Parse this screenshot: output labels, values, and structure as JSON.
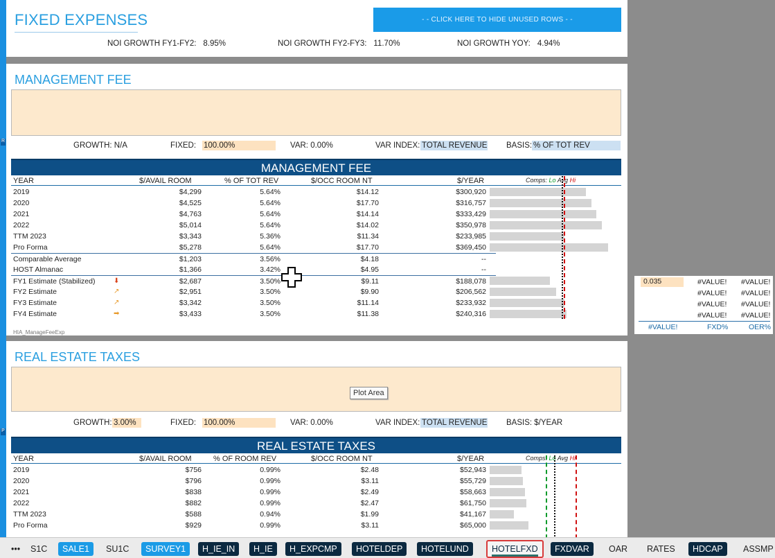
{
  "header": {
    "title": "FIXED EXPENSES",
    "hide_button": "- - CLICK HERE TO HIDE UNUSED ROWS - -",
    "noi": [
      {
        "label": "NOI GROWTH FY1-FY2:",
        "value": "8.95%"
      },
      {
        "label": "NOI GROWTH FY2-FY3:",
        "value": "11.70%"
      },
      {
        "label": "NOI GROWTH YOY:",
        "value": "4.94%"
      }
    ]
  },
  "mgmt": {
    "title": "MANAGEMENT FEE",
    "params": {
      "growth_label": "GROWTH:",
      "growth": "N/A",
      "fixed_label": "FIXED:",
      "fixed": "100.00%",
      "var_label": "VAR:",
      "var": "0.00%",
      "varindex_label": "VAR INDEX:",
      "varindex": "TOTAL REVENUE",
      "basis_label": "BASIS:",
      "basis": "% OF TOT REV"
    },
    "band": "MANAGEMENT FEE",
    "headers": [
      "YEAR",
      "$/AVAIL ROOM",
      "% OF TOT REV",
      "$/OCC ROOM NT",
      "$/YEAR"
    ],
    "comps": {
      "label": "Comps:",
      "lo": "Lo",
      "avg": "Avg",
      "hi": "Hi"
    },
    "rows": [
      {
        "year": "2019",
        "a": "$4,299",
        "b": "5.64%",
        "c": "$14.12",
        "d": "$300,920",
        "bar": 300920
      },
      {
        "year": "2020",
        "a": "$4,525",
        "b": "5.64%",
        "c": "$17.70",
        "d": "$316,757",
        "bar": 316757
      },
      {
        "year": "2021",
        "a": "$4,763",
        "b": "5.64%",
        "c": "$14.14",
        "d": "$333,429",
        "bar": 333429
      },
      {
        "year": "2022",
        "a": "$5,014",
        "b": "5.64%",
        "c": "$14.02",
        "d": "$350,978",
        "bar": 350978
      },
      {
        "year": "TTM 2023",
        "a": "$3,343",
        "b": "5.36%",
        "c": "$11.34",
        "d": "$233,985",
        "bar": 233985
      },
      {
        "year": "Pro Forma",
        "a": "$5,278",
        "b": "5.64%",
        "c": "$17.70",
        "d": "$369,450",
        "bar": 369450
      },
      {
        "year": "Comparable Average",
        "a": "$1,203",
        "b": "3.56%",
        "c": "$4.18",
        "d": "--",
        "bar": 0
      },
      {
        "year": "HOST Almanac",
        "a": "$1,366",
        "b": "3.42%",
        "c": "$4.95",
        "d": "--",
        "bar": 0
      },
      {
        "year": "FY1 Estimate (Stabilized)",
        "a": "$2,687",
        "b": "3.50%",
        "c": "$9.11",
        "d": "$188,078",
        "bar": 188078,
        "arrow": "down"
      },
      {
        "year": "FY2 Estimate",
        "a": "$2,951",
        "b": "3.50%",
        "c": "$9.90",
        "d": "$206,562",
        "bar": 206562,
        "arrow": "up"
      },
      {
        "year": "FY3 Estimate",
        "a": "$3,342",
        "b": "3.50%",
        "c": "$11.14",
        "d": "$233,932",
        "bar": 233932,
        "arrow": "up"
      },
      {
        "year": "FY4 Estimate",
        "a": "$3,433",
        "b": "3.50%",
        "c": "$11.38",
        "d": "$240,316",
        "bar": 240316,
        "arrow": "right"
      }
    ],
    "bar_max": 369450,
    "footer_name": "HIA_ManageFeeExp"
  },
  "side": {
    "cells": [
      "0.035",
      "#VALUE!",
      "#VALUE!",
      "#VALUE!",
      "#VALUE!",
      "#VALUE!",
      "#VALUE!",
      "#VALUE!",
      "#VALUE!"
    ],
    "footer": [
      "#VALUE!",
      "FXD%",
      "OER%"
    ]
  },
  "ret": {
    "title": "REAL ESTATE TAXES",
    "plot_tip": "Plot Area",
    "params": {
      "growth_label": "GROWTH:",
      "growth": "3.00%",
      "fixed_label": "FIXED:",
      "fixed": "100.00%",
      "var_label": "VAR:",
      "var": "0.00%",
      "varindex_label": "VAR INDEX:",
      "varindex": "TOTAL REVENUE",
      "basis_label": "BASIS:",
      "basis": "$/YEAR"
    },
    "band": "REAL ESTATE TAXES",
    "headers": [
      "YEAR",
      "$/AVAIL ROOM",
      "% OF ROOM REV",
      "$/OCC ROOM NT",
      "$/YEAR"
    ],
    "comps": {
      "label": "Comps:",
      "lo": "Lo",
      "avg": "Avg",
      "hi": "Hi"
    },
    "rows": [
      {
        "year": "2019",
        "a": "$756",
        "b": "0.99%",
        "c": "$2.48",
        "d": "$52,943",
        "bar": 52943
      },
      {
        "year": "2020",
        "a": "$796",
        "b": "0.99%",
        "c": "$3.11",
        "d": "$55,729",
        "bar": 55729
      },
      {
        "year": "2021",
        "a": "$838",
        "b": "0.99%",
        "c": "$2.49",
        "d": "$58,663",
        "bar": 58663
      },
      {
        "year": "2022",
        "a": "$882",
        "b": "0.99%",
        "c": "$2.47",
        "d": "$61,750",
        "bar": 61750
      },
      {
        "year": "TTM 2023",
        "a": "$588",
        "b": "0.94%",
        "c": "$1.99",
        "d": "$41,167",
        "bar": 41167
      },
      {
        "year": "Pro Forma",
        "a": "$929",
        "b": "0.99%",
        "c": "$3.11",
        "d": "$65,000",
        "bar": 65000
      }
    ],
    "bar_max": 65000
  },
  "tabs": [
    {
      "label": "•••",
      "style": "plain"
    },
    {
      "label": "S1C",
      "style": "plain"
    },
    {
      "label": "SALE1",
      "style": "light"
    },
    {
      "label": "SU1C",
      "style": "plain"
    },
    {
      "label": "SURVEY1",
      "style": "light"
    },
    {
      "label": "H_IE_IN",
      "style": "dark"
    },
    {
      "label": "H_IE",
      "style": "dark"
    },
    {
      "label": "H_EXPCMP",
      "style": "dark"
    },
    {
      "label": "HOTELDEP",
      "style": "dark"
    },
    {
      "label": "HOTELUND",
      "style": "dark"
    },
    {
      "label": "HOTELFXD",
      "style": "active"
    },
    {
      "label": "FXDVAR",
      "style": "dark"
    },
    {
      "label": "OAR",
      "style": "plain"
    },
    {
      "label": "RATES",
      "style": "plain"
    },
    {
      "label": "HDCAP",
      "style": "dark"
    },
    {
      "label": "ASSMP",
      "style": "plain"
    }
  ]
}
